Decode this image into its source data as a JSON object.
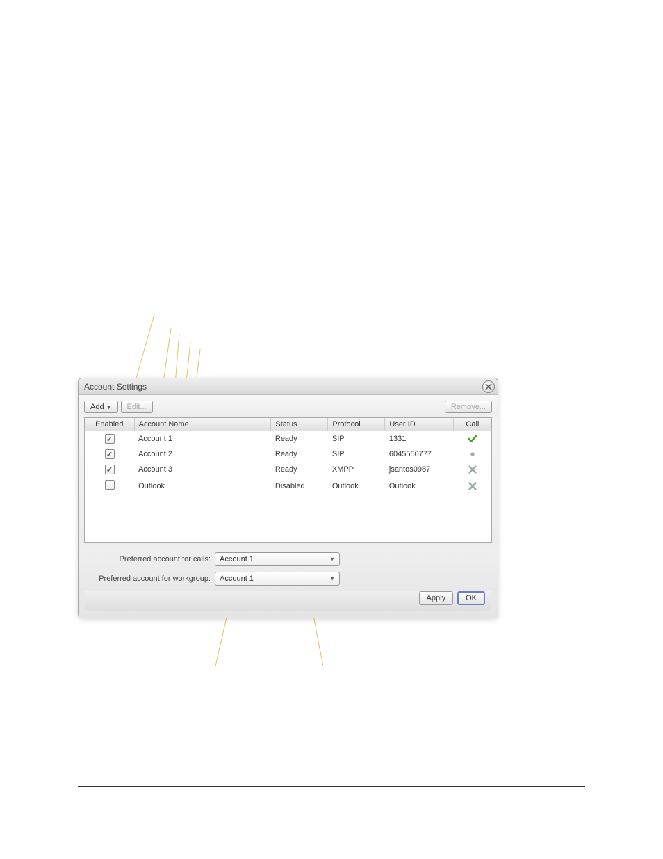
{
  "dialog": {
    "title": "Account Settings",
    "add_label": "Add",
    "edit_label": "Edit...",
    "remove_label": "Remove...",
    "apply_label": "Apply",
    "ok_label": "OK"
  },
  "columns": {
    "enabled": "Enabled",
    "account_name": "Account Name",
    "status": "Status",
    "protocol": "Protocol",
    "user_id": "User ID",
    "call": "Call"
  },
  "rows": [
    {
      "enabled": true,
      "name": "Account 1",
      "status": "Ready",
      "protocol": "SIP",
      "user_id": "1331",
      "call": "check"
    },
    {
      "enabled": true,
      "name": "Account 2",
      "status": "Ready",
      "protocol": "SIP",
      "user_id": "6045550777",
      "call": "dot"
    },
    {
      "enabled": true,
      "name": "Account 3",
      "status": "Ready",
      "protocol": "XMPP",
      "user_id": "jsantos0987",
      "call": "x"
    },
    {
      "enabled": false,
      "name": "Outlook",
      "status": "Disabled",
      "protocol": "Outlook",
      "user_id": "Outlook",
      "call": "x"
    }
  ],
  "prefs": {
    "calls_label": "Preferred account for calls:",
    "calls_value": "Account 1",
    "workgroup_label": "Preferred account for workgroup:",
    "workgroup_value": "Account 1"
  }
}
